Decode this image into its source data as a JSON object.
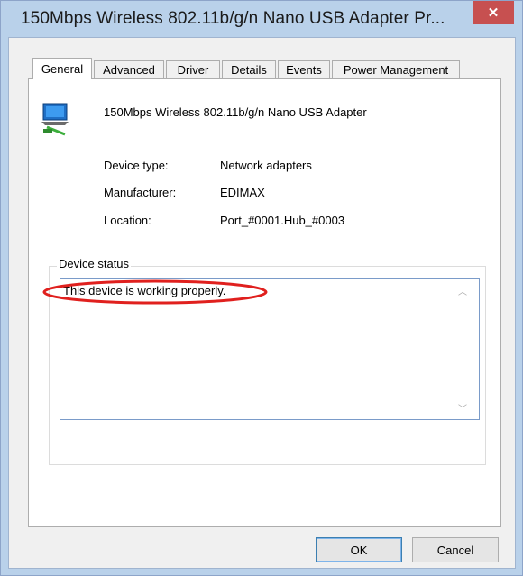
{
  "window": {
    "title": "150Mbps Wireless 802.11b/g/n Nano USB Adapter Pr...",
    "close_glyph": "✕"
  },
  "tabs": [
    {
      "label": "General",
      "active": true
    },
    {
      "label": "Advanced"
    },
    {
      "label": "Driver"
    },
    {
      "label": "Details"
    },
    {
      "label": "Events"
    },
    {
      "label": "Power Management"
    }
  ],
  "device": {
    "icon": "network-adapter-icon",
    "name": "150Mbps Wireless 802.11b/g/n Nano USB Adapter",
    "properties": [
      {
        "label": "Device type:",
        "value": "Network adapters"
      },
      {
        "label": "Manufacturer:",
        "value": "EDIMAX"
      },
      {
        "label": "Location:",
        "value": "Port_#0001.Hub_#0003"
      }
    ]
  },
  "status": {
    "group_label": "Device status",
    "text": "This device is working properly.",
    "highlight_color": "#e0201e"
  },
  "buttons": {
    "ok": "OK",
    "cancel": "Cancel"
  },
  "colors": {
    "frame": "#b9d1ea",
    "close": "#c75050",
    "client": "#f0f0f0"
  }
}
